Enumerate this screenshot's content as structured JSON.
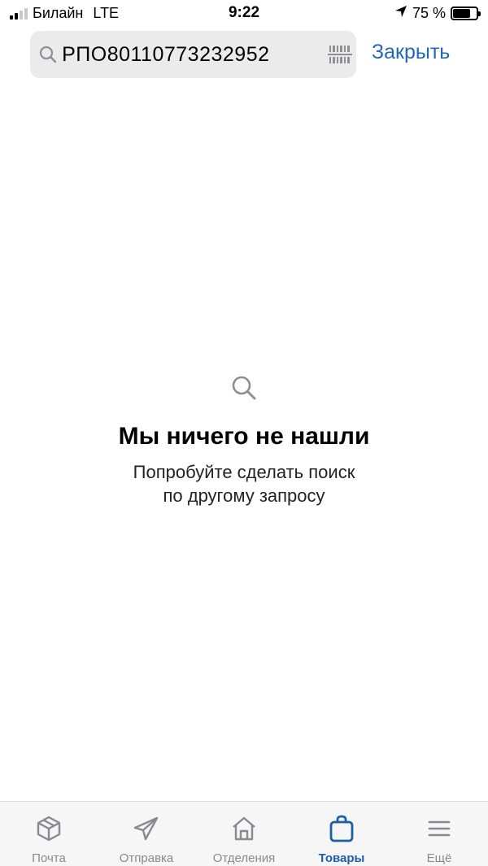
{
  "status_bar": {
    "carrier": "Билайн",
    "network": "LTE",
    "time": "9:22",
    "battery": "75 %",
    "battery_level": 0.75
  },
  "search": {
    "value": "РПО80110773232952",
    "close_label": "Закрыть"
  },
  "empty_state": {
    "title": "Мы ничего не нашли",
    "subtitle_line1": "Попробуйте сделать поиск",
    "subtitle_line2": "по другому запросу"
  },
  "tabs": [
    {
      "label": "Почта",
      "icon": "box-icon",
      "active": false
    },
    {
      "label": "Отправка",
      "icon": "paper-plane-icon",
      "active": false
    },
    {
      "label": "Отделения",
      "icon": "home-icon",
      "active": false
    },
    {
      "label": "Товары",
      "icon": "shopping-bag-icon",
      "active": true
    },
    {
      "label": "Ещё",
      "icon": "menu-icon",
      "active": false
    }
  ],
  "colors": {
    "accent": "#2467b8",
    "active_tab": "#1c5fa8",
    "inactive": "#8a8a8e",
    "search_bg": "#ebebeb",
    "tabbar_bg": "#f6f6f7"
  }
}
